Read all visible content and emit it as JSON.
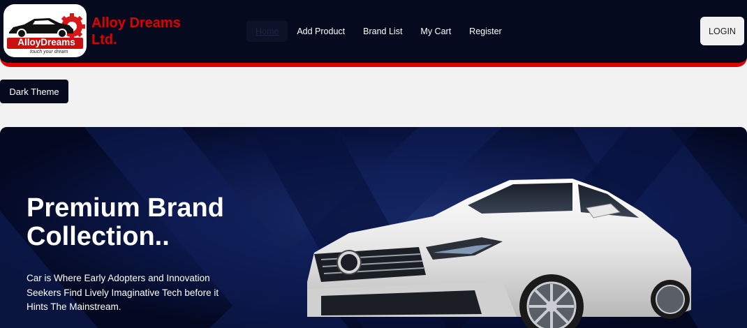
{
  "header": {
    "logo": {
      "wordmark": "AlloyDreams",
      "tagline": "touch your dream",
      "icon": "car-logo-icon"
    },
    "brand_name": "Alloy Dreams Ltd.",
    "nav": [
      {
        "label": "Home",
        "active": true
      },
      {
        "label": "Add Product",
        "active": false
      },
      {
        "label": "Brand List",
        "active": false
      },
      {
        "label": "My Cart",
        "active": false
      },
      {
        "label": "Register",
        "active": false
      }
    ],
    "login_label": "LOGIN"
  },
  "theme_toggle": {
    "label": "Dark Theme"
  },
  "hero": {
    "title": "Premium Brand Collection..",
    "description": "Car is Where Early Adopters and Innovation Seekers Find Lively Imaginative Tech before it Hints The Mainstream.",
    "image": "white-coupe-car-image"
  },
  "colors": {
    "navy": "#060a1f",
    "accent_red": "#e00000",
    "page_bg": "#f2f2f2"
  }
}
